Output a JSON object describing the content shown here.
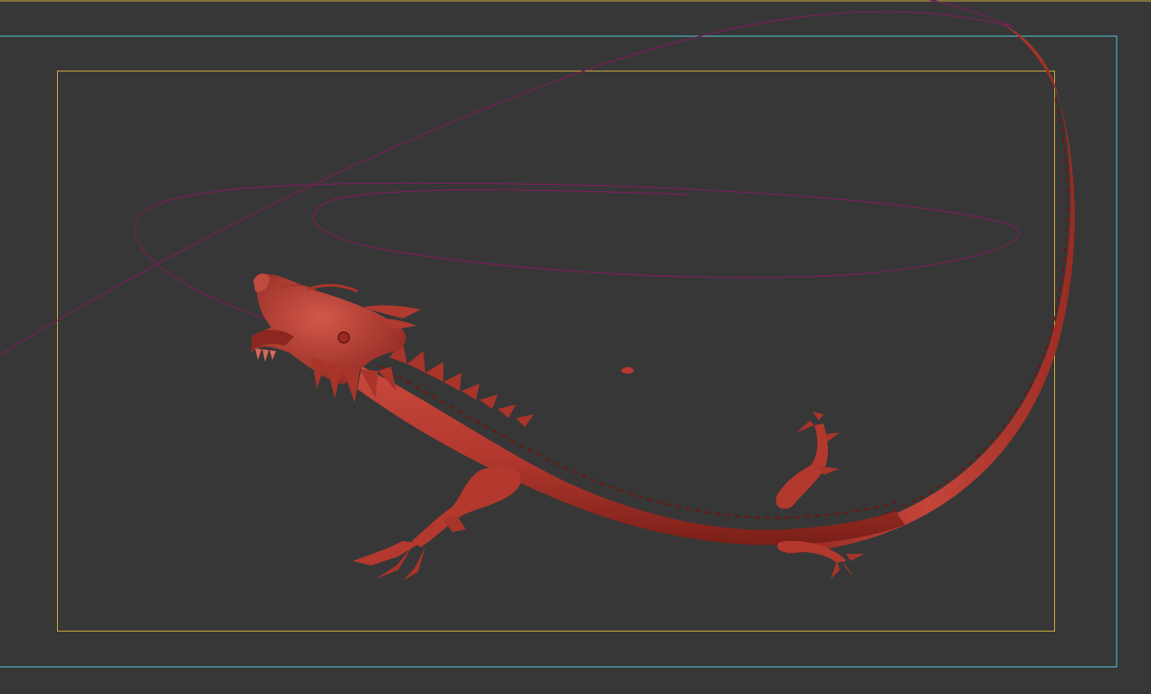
{
  "viewport": {
    "background_color": "#373737",
    "view_type": "perspective",
    "shading_mode": "smooth shaded",
    "safe_frame_outer_color": "#c8a83c",
    "safe_frame_action_color": "#4fc3d6",
    "safe_frame_title_color": "#c8a83c",
    "motion_path_color": "#7a1f5a",
    "model_color": "#b83a30"
  },
  "scene": {
    "model_name": "dragon",
    "path_name": "motion-path-spline",
    "icon": "dragon-model-icon"
  }
}
